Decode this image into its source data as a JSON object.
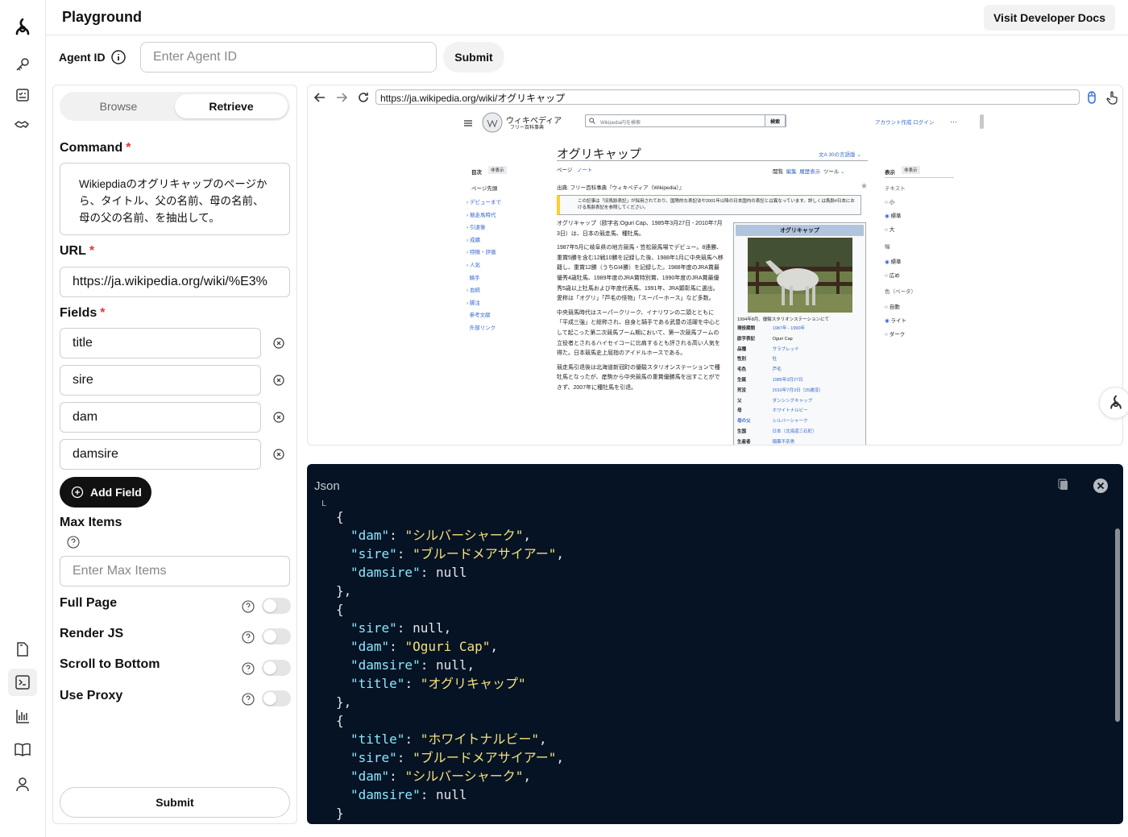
{
  "header": {
    "title": "Playground",
    "docs_label": "Visit Developer Docs"
  },
  "agent": {
    "label": "Agent ID",
    "placeholder": "Enter Agent ID",
    "submit_label": "Submit"
  },
  "tabs": {
    "browse": "Browse",
    "retrieve": "Retrieve"
  },
  "form": {
    "command_label": "Command",
    "command_value": "Wikiepdiaのオグリキャップのページから、タイトル、父の名前、母の名前、母の父の名前、を抽出して。",
    "url_label": "URL",
    "url_value": "https://ja.wikipedia.org/wiki/%E3%",
    "fields_label": "Fields",
    "fields": [
      "title",
      "sire",
      "dam",
      "damsire"
    ],
    "add_field_label": "Add Field",
    "max_items_label": "Max Items",
    "max_items_placeholder": "Enter Max Items",
    "full_page_label": "Full Page",
    "render_js_label": "Render JS",
    "scroll_label": "Scroll to Bottom",
    "proxy_label": "Use Proxy",
    "submit_label": "Submit",
    "required_mark": "*"
  },
  "browser": {
    "url": "https://ja.wikipedia.org/wiki/オグリキャップ",
    "site_name": "ウィキペディア",
    "site_sub": "フリー百科事典",
    "search_placeholder": "Wikipedia内を検索",
    "search_btn": "検索",
    "account": "アカウント作成 ログイン",
    "article_title": "オグリキャップ",
    "langs": "30の言語版",
    "toc": [
      "目次",
      "非表示",
      "ページ先頭",
      "デビューまで",
      "競走馬時代",
      "引退後",
      "成績",
      "特徴・評価",
      "人気",
      "騎手",
      "血統",
      "脚注",
      "参考文献",
      "外部リンク"
    ],
    "tabs_left": [
      "ページ",
      "ノート"
    ],
    "tabs_right": [
      "閲覧",
      "編集",
      "履歴表示",
      "ツール"
    ],
    "source": "出典: フリー百科事典『ウィキペディア（Wikipedia）』",
    "notice": "この記事は「旧馬齢表記」が採用されており、国際的な表記法や2001年以降の日本国内の表記とは異なっています。詳しくは馬齢#日本における馬齢表記を参照してください。",
    "para1": "オグリキャップ（欧字名:Oguri Cap、1985年3月27日 - 2010年7月3日）は、日本の競走馬、種牡馬。",
    "para2": "1987年5月に岐阜県の地方競馬・笠松競馬場でデビュー。8連勝、重賞5勝を含む12戦10勝を記録した後、1988年1月に中央競馬へ移籍し、重賞12勝（うちGI4勝）を記録した。1988年度のJRA賞最優秀4歳牡馬、1989年度のJRA賞特別賞、1990年度のJRA賞最優秀5歳以上牡馬および年度代表馬、1991年、JRA顕彰馬に選出。愛称は「オグリ」「芦毛の怪物」「スーパーホース」など多数。",
    "para3": "中央競馬時代はスーパークリーク、イナリワンの二頭とともに「平成三強」と総称され、自身と騎手である武豊の活躍を中心として起こった第二次競馬ブーム期において、第一次競馬ブームの立役者とされるハイセイコーに比肩するとも評される高い人気を得た。日本競馬史上屈指のアイドルホースである。",
    "para4": "競走馬引退後は北海道新冠町の優駿スタリオンステーションで種牡馬となったが、産駒から中央競馬の重賞優勝馬を出すことができず、2007年に種牡馬を引退。",
    "infobox_title": "オグリキャップ",
    "infobox_caption": "1994年8月、優駿スタリオンステーションにて",
    "infobox_rows": [
      [
        "現役期間",
        "1987年 - 1990年"
      ],
      [
        "欧字表記",
        "Oguri Cap"
      ],
      [
        "品種",
        "サラブレッド"
      ],
      [
        "性別",
        "牡"
      ],
      [
        "毛色",
        "芦毛"
      ],
      [
        "生誕",
        "1985年3月27日"
      ],
      [
        "死没",
        "2010年7月3日（25歳没）"
      ],
      [
        "父",
        "ダンシングキャップ"
      ],
      [
        "母",
        "ホワイトナルビー"
      ],
      [
        "母の父",
        "シルバーシャーク"
      ],
      [
        "生国",
        "日本（北海道三石町）"
      ],
      [
        "生産者",
        "稲葉不奈男"
      ]
    ],
    "side_title": "表示",
    "side_hide": "非表示",
    "side_text": "テキスト",
    "side_opts1": [
      "小",
      "標準",
      "大"
    ],
    "side_width": "幅",
    "side_opts2": [
      "標準",
      "広め"
    ],
    "side_color": "色（ベータ）",
    "side_opts3": [
      "自動",
      "ライト",
      "ダーク"
    ]
  },
  "json_panel": {
    "title": "Json",
    "lines": [
      "L",
      "{",
      "\"dam\": \"シルバーシャーク\",",
      "\"sire\": \"ブルードメアサイアー\",",
      "\"damsire\": null",
      "},",
      "{",
      "\"sire\": null,",
      "\"dam\": \"Oguri Cap\",",
      "\"damsire\": null,",
      "\"title\": \"オグリキャップ\"",
      "},",
      "{",
      "\"title\": \"ホワイトナルビー\",",
      "\"sire\": \"ブルードメアサイアー\",",
      "\"dam\": \"シルバーシャーク\",",
      "\"damsire\": null",
      "}"
    ]
  },
  "icons": [
    "logo-icon",
    "key-icon",
    "checklist-icon",
    "handshake-icon",
    "document-icon",
    "terminal-icon",
    "chart-icon",
    "book-icon",
    "user-icon"
  ]
}
